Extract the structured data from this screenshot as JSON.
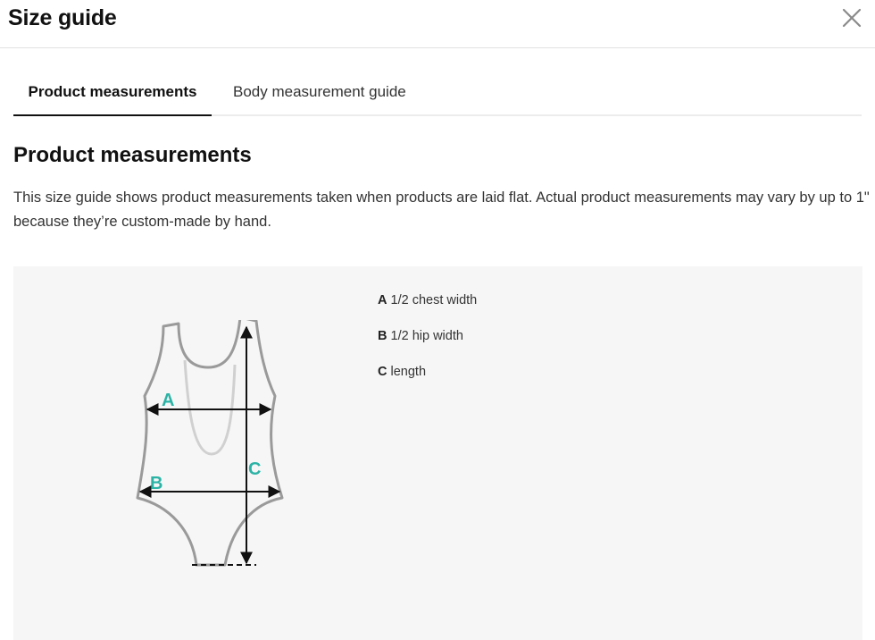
{
  "header": {
    "title": "Size guide",
    "close_icon": "close-icon"
  },
  "tabs": [
    {
      "label": "Product measurements",
      "active": true
    },
    {
      "label": "Body measurement guide",
      "active": false
    }
  ],
  "content": {
    "heading": "Product measurements",
    "description": "This size guide shows product measurements taken when products are laid flat. Actual product measurements may vary by up to 1\" because they’re custom-made by hand."
  },
  "diagram": {
    "labels": {
      "a": "A",
      "b": "B",
      "c": "C"
    },
    "accent_color": "#2bb3a6",
    "outline_color": "#9a9a9a"
  },
  "legend": [
    {
      "key": "A",
      "text": " 1/2 chest width"
    },
    {
      "key": "B",
      "text": " 1/2 hip width"
    },
    {
      "key": "C",
      "text": " length"
    }
  ]
}
